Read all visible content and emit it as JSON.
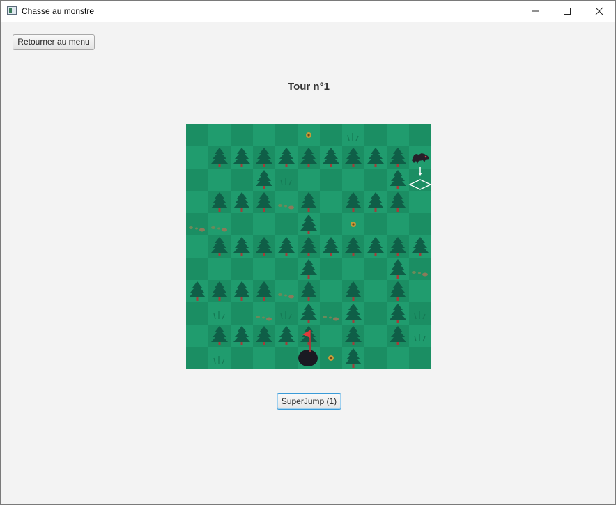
{
  "window": {
    "title": "Chasse au monstre"
  },
  "toolbar": {
    "back_to_menu_label": "Retourner au menu"
  },
  "game": {
    "turn_label": "Tour n°1",
    "superjump_label": "SuperJump (1)",
    "grid": {
      "rows": 11,
      "cols": 11,
      "trees": [
        [
          1,
          1
        ],
        [
          1,
          2
        ],
        [
          1,
          3
        ],
        [
          1,
          4
        ],
        [
          1,
          5
        ],
        [
          1,
          6
        ],
        [
          1,
          7
        ],
        [
          1,
          8
        ],
        [
          1,
          9
        ],
        [
          2,
          3
        ],
        [
          2,
          9
        ],
        [
          3,
          1
        ],
        [
          3,
          2
        ],
        [
          3,
          3
        ],
        [
          3,
          5
        ],
        [
          3,
          7
        ],
        [
          3,
          8
        ],
        [
          3,
          9
        ],
        [
          4,
          5
        ],
        [
          5,
          1
        ],
        [
          5,
          2
        ],
        [
          5,
          3
        ],
        [
          5,
          4
        ],
        [
          5,
          5
        ],
        [
          5,
          6
        ],
        [
          5,
          7
        ],
        [
          5,
          8
        ],
        [
          5,
          9
        ],
        [
          5,
          10
        ],
        [
          6,
          5
        ],
        [
          6,
          9
        ],
        [
          7,
          0
        ],
        [
          7,
          1
        ],
        [
          7,
          2
        ],
        [
          7,
          3
        ],
        [
          7,
          5
        ],
        [
          7,
          7
        ],
        [
          7,
          9
        ],
        [
          8,
          5
        ],
        [
          8,
          7
        ],
        [
          8,
          9
        ],
        [
          9,
          1
        ],
        [
          9,
          2
        ],
        [
          9,
          3
        ],
        [
          9,
          4
        ],
        [
          9,
          5
        ],
        [
          9,
          7
        ],
        [
          9,
          9
        ],
        [
          10,
          7
        ]
      ],
      "grass": [
        [
          0,
          7
        ],
        [
          2,
          4
        ],
        [
          8,
          1
        ],
        [
          8,
          4
        ],
        [
          8,
          10
        ],
        [
          9,
          10
        ],
        [
          10,
          1
        ]
      ],
      "pebbles": [
        [
          3,
          4
        ],
        [
          4,
          0
        ],
        [
          4,
          1
        ],
        [
          6,
          10
        ],
        [
          7,
          4
        ],
        [
          8,
          3
        ],
        [
          8,
          6
        ]
      ],
      "flowers": [
        [
          0,
          5
        ],
        [
          4,
          7
        ],
        [
          10,
          6
        ]
      ],
      "monster": {
        "row": 1,
        "col": 10
      },
      "move_target": {
        "row": 2,
        "col": 10
      },
      "hunter_hole": {
        "row": 10,
        "col": 5
      },
      "flag": {
        "row": 9,
        "col": 5
      }
    },
    "colors": {
      "tile_dark": "#1b8e63",
      "tile_light": "#209c6e",
      "tree": "#0f5e47",
      "trunk": "#a53a3a",
      "flag": "#e03a3a",
      "hole": "#1a1a22"
    }
  }
}
